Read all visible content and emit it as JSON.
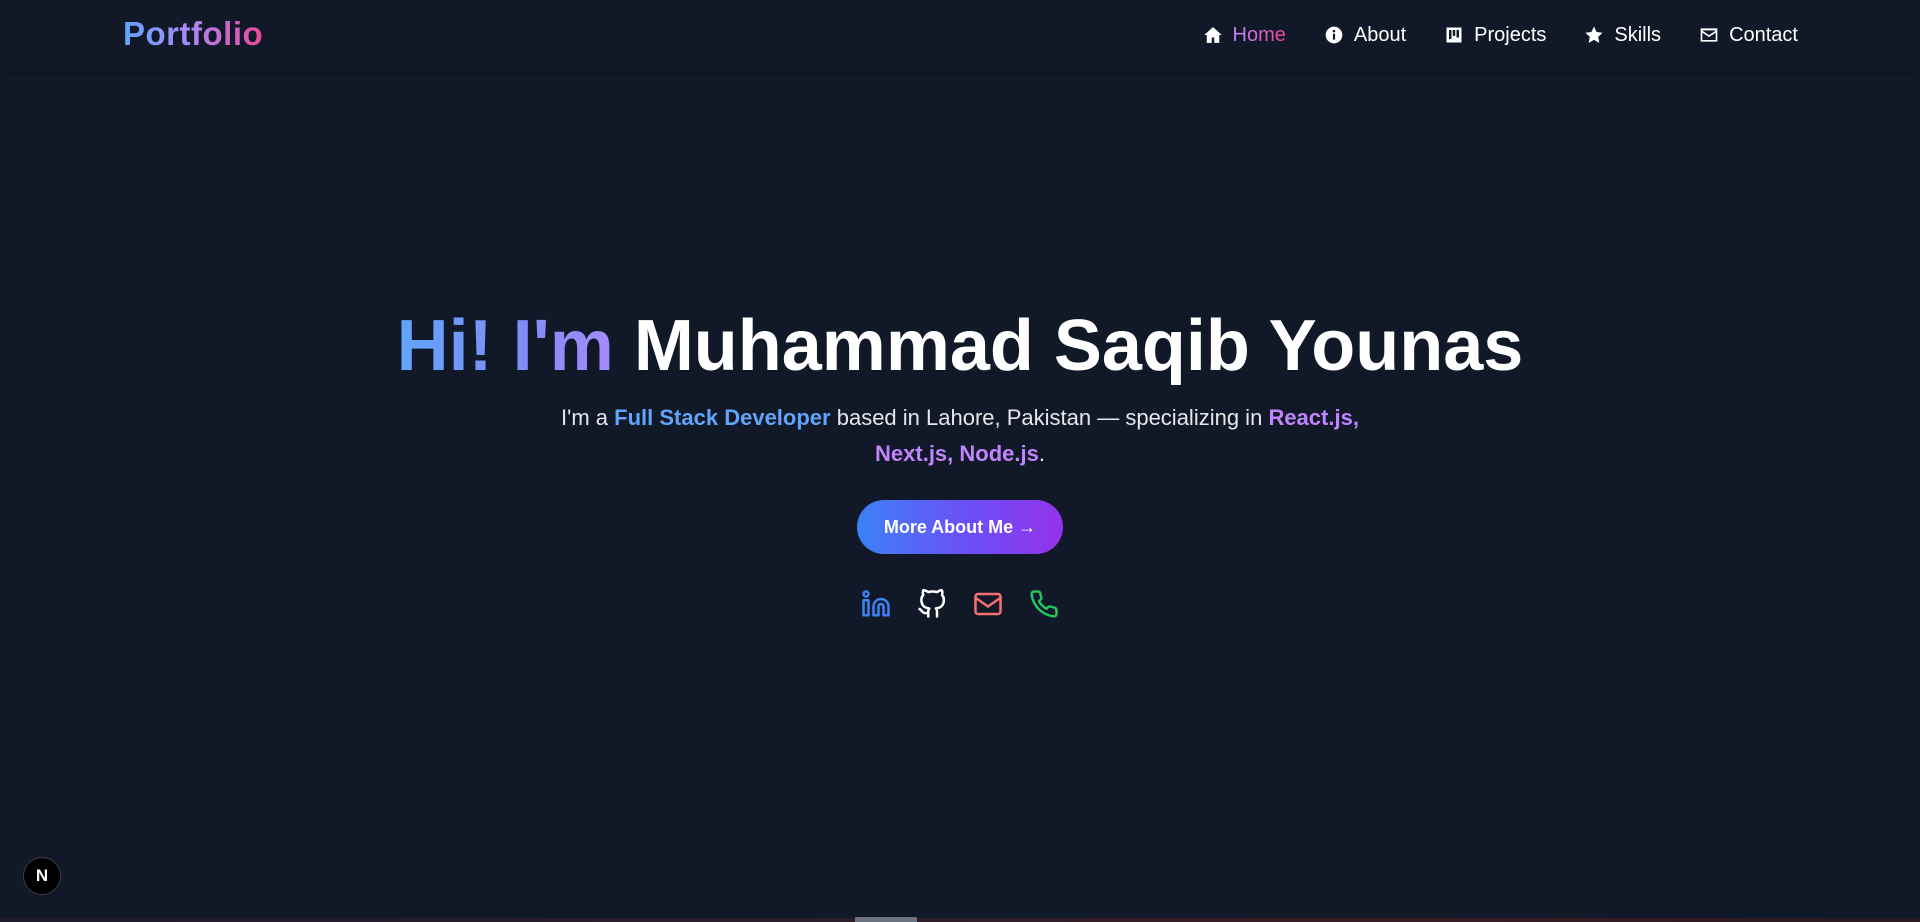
{
  "brand": {
    "logo": "Portfolio"
  },
  "nav": {
    "items": [
      {
        "label": "Home",
        "icon": "home-icon",
        "active": true
      },
      {
        "label": "About",
        "icon": "info-icon",
        "active": false
      },
      {
        "label": "Projects",
        "icon": "projects-icon",
        "active": false
      },
      {
        "label": "Skills",
        "icon": "star-icon",
        "active": false
      },
      {
        "label": "Contact",
        "icon": "mail-icon",
        "active": false
      }
    ]
  },
  "hero": {
    "greeting": "Hi! I'm",
    "name": "Muhammad Saqib Younas",
    "subtitle": {
      "part1": "I'm a",
      "role": "Full Stack Developer",
      "part2": "based in Lahore, Pakistan — specializing in",
      "stack": "React.js, Next.js, Node.js",
      "end": "."
    },
    "cta_label": "More About Me →"
  },
  "socials": [
    {
      "name": "linkedin-icon",
      "color": "#3b82f6"
    },
    {
      "name": "github-icon",
      "color": "#ffffff"
    },
    {
      "name": "email-icon",
      "color": "#f87171"
    },
    {
      "name": "phone-icon",
      "color": "#22c55e"
    }
  ],
  "dev_badge": {
    "label": "N"
  },
  "colors": {
    "background": "#111827",
    "accent_blue": "#60a5fa",
    "accent_purple": "#c084fc",
    "accent_pink": "#ec4899"
  }
}
